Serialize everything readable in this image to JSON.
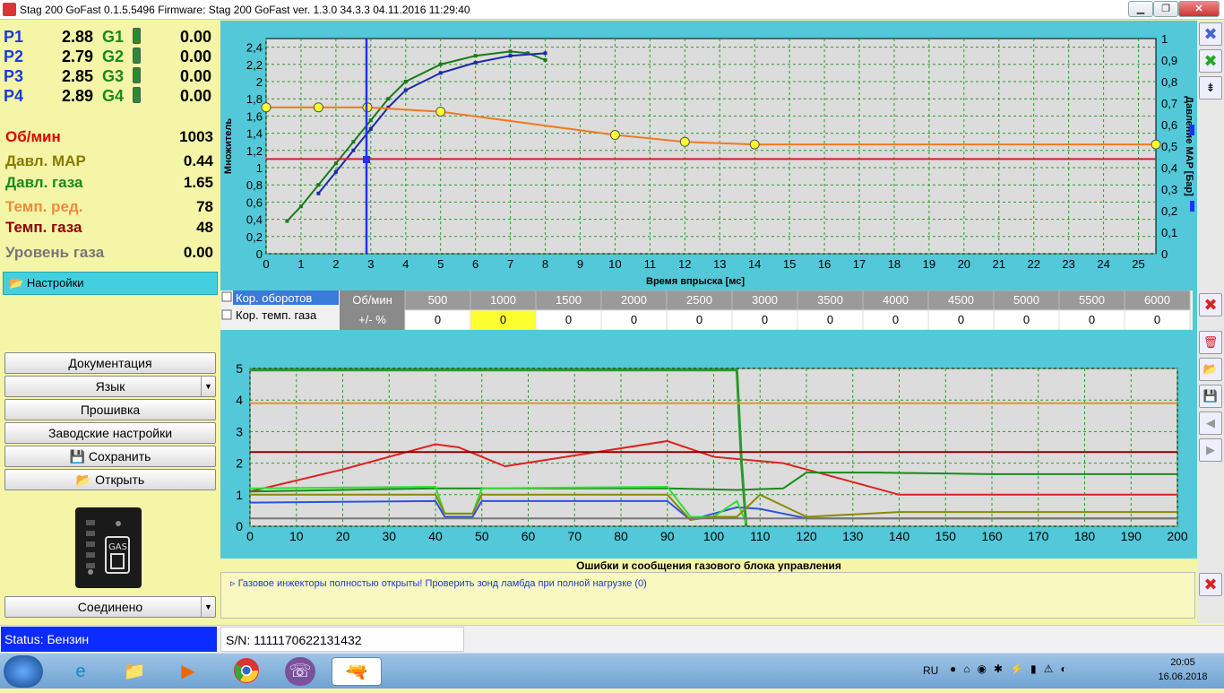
{
  "window": {
    "title": "Stag 200 GoFast 0.1.5.5496 Firmware: Stag 200 GoFast  ver. 1.3.0  34.3.3  04.11.2016 11:29:40",
    "min": "▁",
    "restore": "❐",
    "close": "✕"
  },
  "injectors": [
    {
      "p": "P1",
      "pv": "2.88",
      "g": "G1",
      "gv": "0.00"
    },
    {
      "p": "P2",
      "pv": "2.79",
      "g": "G2",
      "gv": "0.00"
    },
    {
      "p": "P3",
      "pv": "2.85",
      "g": "G3",
      "gv": "0.00"
    },
    {
      "p": "P4",
      "pv": "2.89",
      "g": "G4",
      "gv": "0.00"
    }
  ],
  "values": [
    {
      "label": "Об/мин",
      "value": "1003",
      "color": "#e00000"
    },
    {
      "label": "Давл. MAP",
      "value": "0.44",
      "color": "#8a7a00"
    },
    {
      "label": "Давл. газа",
      "value": "1.65",
      "color": "#1a8a1a"
    },
    {
      "label": "Темп. ред.",
      "value": "78",
      "color": "#f08a3a"
    },
    {
      "label": "Темп. газа",
      "value": "48",
      "color": "#8b0000"
    },
    {
      "label": "Уровень газа",
      "value": "0.00",
      "color": "#777777"
    }
  ],
  "settings_tab": "Настройки",
  "buttons": {
    "docs": "Документация",
    "lang": "Язык",
    "firmware": "Прошивка",
    "factory": "Заводские настройки",
    "save": "Сохранить",
    "open": "Открыть",
    "connected": "Соединено"
  },
  "gas_label": "GAS",
  "chart_top": {
    "ylabel": "Множитель",
    "y2label": "Давление MAP [Бар]",
    "xlabel": "Время впрыска [мс]",
    "xticks": [
      "0",
      "1",
      "2",
      "3",
      "4",
      "5",
      "6",
      "7",
      "8",
      "9",
      "10",
      "11",
      "12",
      "13",
      "14",
      "15",
      "16",
      "17",
      "18",
      "19",
      "20",
      "21",
      "22",
      "23",
      "24",
      "25"
    ],
    "yticks": [
      "0",
      "0,2",
      "0,4",
      "0,6",
      "0,8",
      "1",
      "1,2",
      "1,4",
      "1,6",
      "1,8",
      "2",
      "2,2",
      "2,4"
    ],
    "y2ticks": [
      "0",
      "0,1",
      "0,2",
      "0,3",
      "0,4",
      "0,5",
      "0,6",
      "0,7",
      "0,8",
      "0,9",
      "1"
    ]
  },
  "corr": {
    "chk1": "Кор. оборотов",
    "chk2": "Кор. темп. газа",
    "hdr": "Об/мин",
    "unit": "+/- %",
    "rpm": [
      "500",
      "1000",
      "1500",
      "2000",
      "2500",
      "3000",
      "3500",
      "4000",
      "4500",
      "5000",
      "5500",
      "6000"
    ],
    "vals": [
      "0",
      "0",
      "0",
      "0",
      "0",
      "0",
      "0",
      "0",
      "0",
      "0",
      "0",
      "0"
    ]
  },
  "chart_bottom": {
    "xticks": [
      "0",
      "10",
      "20",
      "30",
      "40",
      "50",
      "60",
      "70",
      "80",
      "90",
      "100",
      "110",
      "120",
      "130",
      "140",
      "150",
      "160",
      "170",
      "180",
      "190",
      "200"
    ],
    "yticks": [
      "0",
      "1",
      "2",
      "3",
      "4",
      "5"
    ]
  },
  "errors": {
    "title": "Ошибки и сообщения газового блока управления",
    "msg": "Газовое инжекторы полностью открыты! Проверить зонд ламбда при полной нагрузке (0)"
  },
  "status": {
    "mode": "Status: Бензин",
    "sn": "S/N: 1111170622131432"
  },
  "taskbar": {
    "lang": "RU",
    "time": "20:05",
    "date": "16.06.2018"
  },
  "chart_data": [
    {
      "type": "scatter",
      "ylabel": "Множитель",
      "y2label": "Давление MAP [Бар]",
      "xlabel": "Время впрыска [мс]",
      "xlim": [
        0,
        25.5
      ],
      "ylim": [
        0,
        2.5
      ],
      "y2lim": [
        0,
        1
      ],
      "grid": true,
      "series": [
        {
          "color": "#1a7a1a",
          "x": [
            0.6,
            1,
            1.5,
            2,
            2.5,
            3,
            3.5,
            4,
            5,
            6,
            7,
            7.5,
            8
          ],
          "y": [
            0.38,
            0.55,
            0.8,
            1.05,
            1.3,
            1.55,
            1.8,
            2.0,
            2.2,
            2.3,
            2.35,
            2.33,
            2.25
          ]
        },
        {
          "color": "#1a2aaa",
          "x": [
            1.5,
            2,
            2.5,
            3,
            3.5,
            4,
            5,
            6,
            7,
            8
          ],
          "y": [
            0.7,
            0.95,
            1.2,
            1.45,
            1.7,
            1.9,
            2.1,
            2.22,
            2.3,
            2.33
          ]
        },
        {
          "color": "#f07a20",
          "x": [
            0,
            1.5,
            2.9,
            5,
            10,
            12,
            14,
            25.5
          ],
          "y": [
            1.7,
            1.7,
            1.7,
            1.65,
            1.38,
            1.3,
            1.27,
            1.27
          ]
        },
        {
          "color": "#cc2222",
          "x": [
            0,
            25.5
          ],
          "y": [
            1.1,
            1.1
          ]
        }
      ]
    },
    {
      "type": "line",
      "xlim": [
        0,
        200
      ],
      "ylim": [
        0,
        5
      ],
      "grid": true,
      "series": [
        {
          "color": "#e02020",
          "x": [
            0,
            20,
            40,
            45,
            55,
            90,
            100,
            115,
            130,
            140,
            200
          ],
          "y": [
            1.1,
            1.8,
            2.6,
            2.5,
            1.9,
            2.7,
            2.2,
            2.0,
            1.4,
            1.0,
            1.0
          ]
        },
        {
          "color": "#1a8a1a",
          "x": [
            0,
            40,
            60,
            90,
            105,
            115,
            120,
            135,
            160,
            200
          ],
          "y": [
            1.1,
            1.2,
            1.2,
            1.2,
            1.15,
            1.2,
            1.7,
            1.7,
            1.65,
            1.65
          ]
        },
        {
          "color": "#2a9a2a",
          "x": [
            0,
            105,
            106,
            107
          ],
          "y": [
            4.95,
            4.95,
            2,
            0
          ]
        },
        {
          "color": "#f08a3a",
          "x": [
            0,
            200
          ],
          "y": [
            3.9,
            3.9
          ]
        },
        {
          "color": "#8b0000",
          "x": [
            0,
            200
          ],
          "y": [
            2.35,
            2.35
          ]
        },
        {
          "color": "#3050e0",
          "x": [
            0,
            40,
            42,
            48,
            50,
            90,
            95,
            100,
            105,
            110,
            120,
            200
          ],
          "y": [
            0.75,
            0.8,
            0.3,
            0.3,
            0.8,
            0.8,
            0.2,
            0.4,
            0.6,
            0.55,
            0.25,
            0.25
          ]
        },
        {
          "color": "#30e030",
          "x": [
            0,
            40,
            42,
            48,
            50,
            90,
            95,
            100,
            105,
            107
          ],
          "y": [
            1.2,
            1.25,
            0.4,
            0.4,
            1.2,
            1.25,
            0.3,
            0.3,
            0.8,
            0.1
          ]
        },
        {
          "color": "#8a8a00",
          "x": [
            0,
            40,
            42,
            48,
            50,
            90,
            95,
            100,
            105,
            110,
            120,
            140,
            200
          ],
          "y": [
            1.0,
            1.0,
            0.4,
            0.4,
            1.0,
            1.0,
            0.2,
            0.3,
            0.3,
            1.0,
            0.3,
            0.45,
            0.45
          ]
        },
        {
          "color": "#777777",
          "x": [
            0,
            200
          ],
          "y": [
            0.25,
            0.25
          ]
        }
      ]
    }
  ]
}
